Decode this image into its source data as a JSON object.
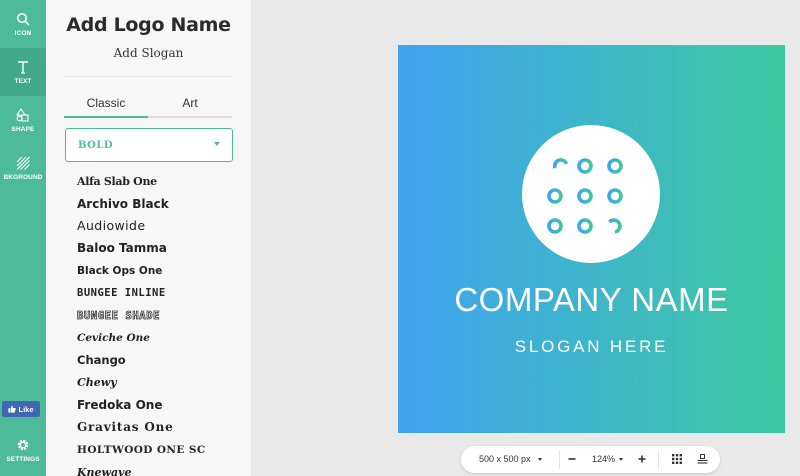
{
  "rail": {
    "items": [
      {
        "label": "ICON",
        "icon": "search-icon"
      },
      {
        "label": "TEXT",
        "icon": "text-t-icon"
      },
      {
        "label": "SHAPE",
        "icon": "shapes-icon"
      },
      {
        "label": "BKGROUND",
        "icon": "background-hatch-icon"
      }
    ],
    "like_label": "Like",
    "settings_label": "SETTINGS"
  },
  "panel": {
    "logo_name": "Add Logo Name",
    "slogan": "Add Slogan",
    "tabs": [
      "Classic",
      "Art"
    ],
    "active_tab": "Classic",
    "font_category": "BOLD",
    "fonts": [
      "Alfa Slab One",
      "Archivo Black",
      "Audiowide",
      "Baloo Tamma",
      "Black Ops One",
      "BUNGEE INLINE",
      "BUNGEE SHADE",
      "Ceviche One",
      "Chango",
      "Chewy",
      "Fredoka One",
      "Gravitas One",
      "HOLTWOOD ONE SC",
      "Knewave"
    ]
  },
  "canvas": {
    "company_name": "COMPANY NAME",
    "slogan": "SLOGAN HERE",
    "gradient_start": "#3fa3f2",
    "gradient_end": "#3ec8a0",
    "logo_icon": "dot-grid-icon"
  },
  "toolbar": {
    "size": "500 x 500 px",
    "zoom": "124%"
  },
  "colors": {
    "accent": "#4dbb9a",
    "rail": "#4dbb9a",
    "facebook": "#4267b2"
  }
}
